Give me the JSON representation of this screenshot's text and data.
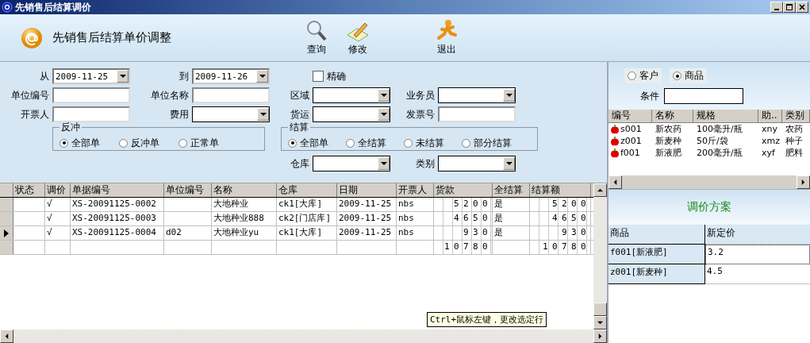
{
  "window": {
    "title": "先销售后结算调价"
  },
  "header": {
    "title": "先销售后结算单价调整",
    "toolbar": [
      {
        "label": "查询",
        "kind": "search"
      },
      {
        "label": "修改",
        "kind": "edit"
      },
      {
        "label": "退出",
        "kind": "exit"
      }
    ]
  },
  "filters": {
    "from": {
      "label": "从",
      "value": "2009-11-25"
    },
    "to": {
      "label": "到",
      "value": "2009-11-26"
    },
    "exact": {
      "label": "精确",
      "checked": false
    },
    "rows": [
      [
        {
          "label": "单位编号",
          "kind": "text"
        },
        {
          "label": "单位名称",
          "kind": "text"
        },
        {
          "label": "区域",
          "kind": "select"
        },
        {
          "label": "业务员",
          "kind": "select"
        }
      ],
      [
        {
          "label": "开票人",
          "kind": "text"
        },
        {
          "label": "费用",
          "kind": "select"
        },
        {
          "label": "货运",
          "kind": "select"
        },
        {
          "label": "发票号",
          "kind": "text"
        }
      ]
    ],
    "reversal": {
      "title": "反冲",
      "options": [
        {
          "label": "全部单",
          "selected": true
        },
        {
          "label": "反冲单",
          "selected": false
        },
        {
          "label": "正常单",
          "selected": false
        }
      ]
    },
    "settlement": {
      "title": "结算",
      "options": [
        {
          "label": "全部单",
          "selected": true
        },
        {
          "label": "全结算",
          "selected": false
        },
        {
          "label": "未结算",
          "selected": false
        },
        {
          "label": "部分结算",
          "selected": false
        }
      ]
    },
    "warehouse": {
      "label": "仓库"
    },
    "category": {
      "label": "类别"
    }
  },
  "grid": {
    "columns": [
      "状态",
      "调价",
      "单据编号",
      "单位编号",
      "名称",
      "仓库",
      "日期",
      "开票人",
      "货款",
      "全结算",
      "结算额"
    ],
    "rows": [
      {
        "current": false,
        "cells": [
          "",
          "√",
          "XS-20091125-0002",
          "",
          "大地种业",
          "ck1[大库]",
          "2009-11-25",
          "nbs",
          "5200",
          "是",
          "5200"
        ]
      },
      {
        "current": false,
        "cells": [
          "",
          "√",
          "XS-20091125-0003",
          "",
          "大地种业888",
          "ck2[门店库]",
          "2009-11-25",
          "nbs",
          "4650",
          "是",
          "4650"
        ]
      },
      {
        "current": true,
        "cells": [
          "",
          "√",
          "XS-20091125-0004",
          "d02",
          "大地种业yu",
          "ck1[大库]",
          "2009-11-25",
          "nbs",
          "930",
          "是",
          "930"
        ]
      }
    ],
    "totals": {
      "amount": "10780",
      "settled_amount": "10780"
    },
    "tooltip": "Ctrl+鼠标左键，更改选定行"
  },
  "lookup": {
    "modes": [
      {
        "label": "客户",
        "selected": false
      },
      {
        "label": "商品",
        "selected": true
      }
    ],
    "condition_label": "条件",
    "columns": [
      "编号",
      "名称",
      "规格",
      "助..",
      "类别"
    ],
    "rows": [
      [
        "s001",
        "新农药",
        "100毫升/瓶",
        "xny",
        "农药"
      ],
      [
        "z001",
        "新麦种",
        "50斤/袋",
        "xmz",
        "种子"
      ],
      [
        "f001",
        "新液肥",
        "200毫升/瓶",
        "xyf",
        "肥料"
      ]
    ]
  },
  "plan": {
    "title": "调价方案",
    "columns": [
      "商品",
      "新定价"
    ],
    "rows": [
      {
        "product": "f001[新液肥]",
        "price": "3.2",
        "focused": true
      },
      {
        "product": "z001[新麦种]",
        "price": "4.5",
        "focused": false
      }
    ]
  }
}
